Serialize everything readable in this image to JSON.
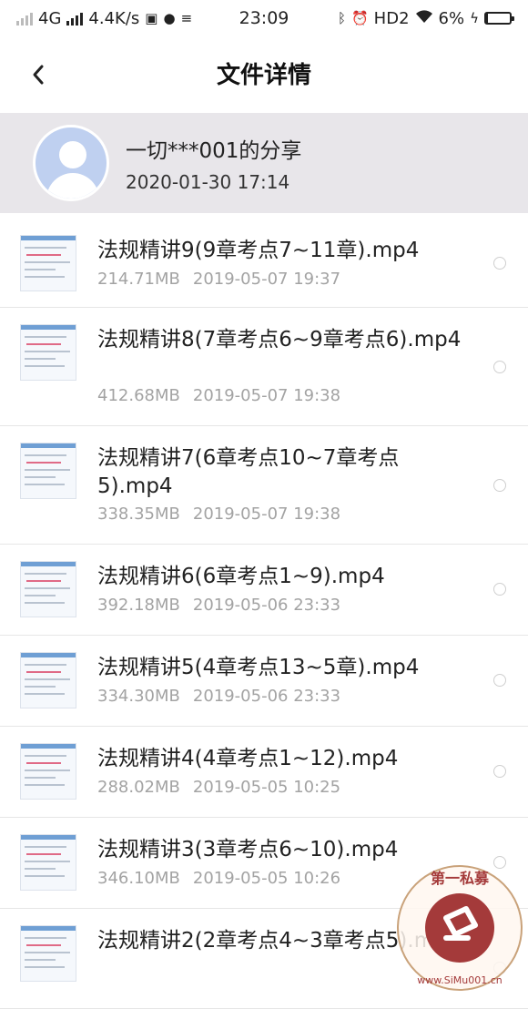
{
  "status_bar": {
    "network": "4G",
    "speed": "4.4K/s",
    "time": "23:09",
    "hd": "HD2",
    "battery": "6%",
    "battery_level": 0.06
  },
  "nav": {
    "title": "文件详情",
    "back_icon": "chevron-left-icon"
  },
  "share": {
    "name": "一切***001的分享",
    "date": "2020-01-30   17:14"
  },
  "files": [
    {
      "name": "法规精讲9(9章考点7~11章).mp4",
      "size": "214.71MB",
      "date": "2019-05-07  19:37"
    },
    {
      "name": "法规精讲8(7章考点6~9章考点6).mp4",
      "size": "412.68MB",
      "date": "2019-05-07  19:38"
    },
    {
      "name": "法规精讲7(6章考点10~7章考点5).mp4",
      "size": "338.35MB",
      "date": "2019-05-07  19:38"
    },
    {
      "name": "法规精讲6(6章考点1~9).mp4",
      "size": "392.18MB",
      "date": "2019-05-06  23:33"
    },
    {
      "name": "法规精讲5(4章考点13~5章).mp4",
      "size": "334.30MB",
      "date": "2019-05-06  23:33"
    },
    {
      "name": "法规精讲4(4章考点1~12).mp4",
      "size": "288.02MB",
      "date": "2019-05-05  10:25"
    },
    {
      "name": "法规精讲3(3章考点6~10).mp4",
      "size": "346.10MB",
      "date": "2019-05-05  10:26"
    },
    {
      "name": "法规精讲2(2章考点4~3章考点5).mp4",
      "size": "",
      "date": ""
    }
  ],
  "watermark": {
    "text_top": "第一私募",
    "text_bottom": "www.SiMu001.cn"
  },
  "colors": {
    "header_bg": "#e8e6ea",
    "avatar_bg": "#bfd0f0",
    "meta_text": "#a3a3a3",
    "stamp_red": "#a43a3a"
  }
}
